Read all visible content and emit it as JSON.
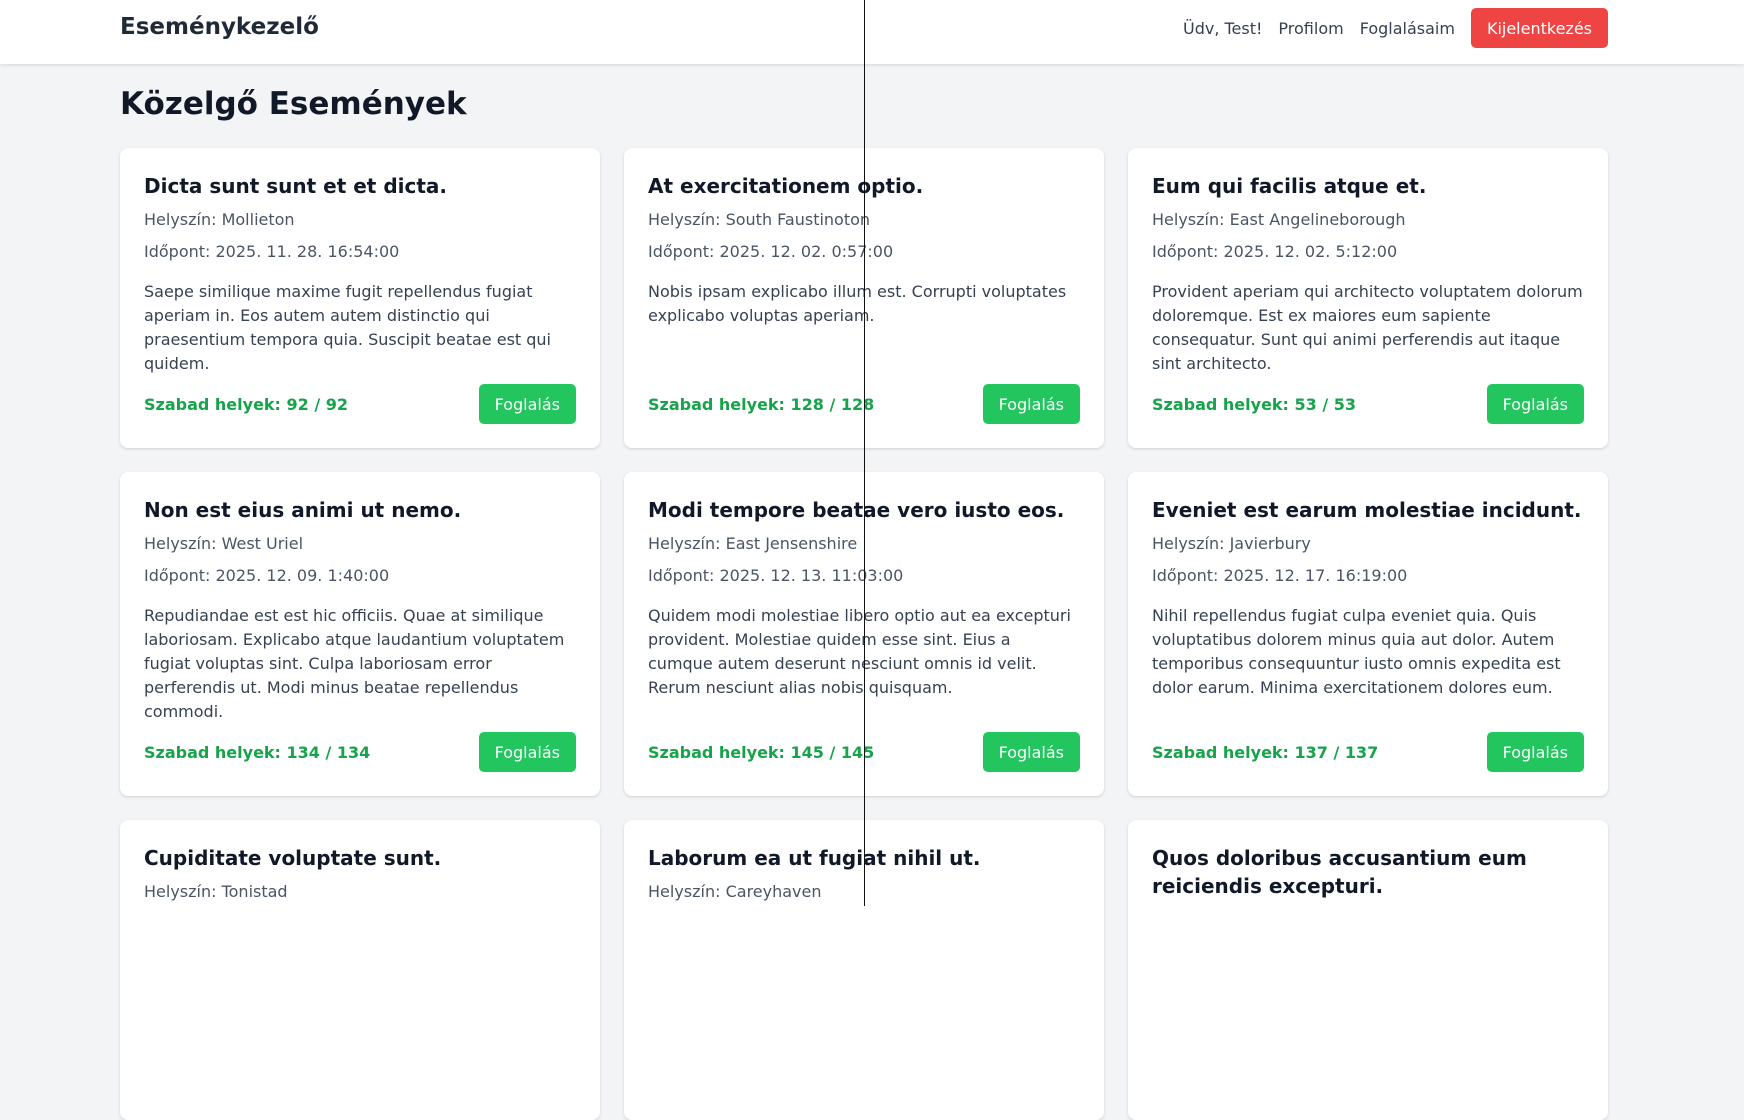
{
  "header": {
    "brand": "Eseménykezelő",
    "greeting": "Üdv, Test!",
    "profile_link": "Profilom",
    "bookings_link": "Foglalásaim",
    "logout_label": "Kijelentkezés"
  },
  "page": {
    "title": "Közelgő Események"
  },
  "labels": {
    "location_prefix": "Helyszín:",
    "time_prefix": "Időpont:",
    "seats_prefix": "Szabad helyek:",
    "book_button": "Foglalás"
  },
  "events": [
    {
      "title": "Dicta sunt sunt et et dicta.",
      "location": "Helyszín: Mollieton",
      "time": "Időpont: 2025. 11. 28. 16:54:00",
      "description": "Saepe similique maxime fugit repellendus fugiat aperiam in. Eos autem autem distinctio qui praesentium tempora quia. Suscipit beatae est qui quidem.",
      "seats": "Szabad helyek: 92 / 92",
      "book": "Foglalás"
    },
    {
      "title": "At exercitationem optio.",
      "location": "Helyszín: South Faustinoton",
      "time": "Időpont: 2025. 12. 02. 0:57:00",
      "description": "Nobis ipsam explicabo illum est. Corrupti voluptates explicabo voluptas aperiam.",
      "seats": "Szabad helyek: 128 / 128",
      "book": "Foglalás"
    },
    {
      "title": "Eum qui facilis atque et.",
      "location": "Helyszín: East Angelineborough",
      "time": "Időpont: 2025. 12. 02. 5:12:00",
      "description": "Provident aperiam qui architecto voluptatem dolorum doloremque. Est ex maiores eum sapiente consequatur. Sunt qui animi perferendis aut itaque sint architecto.",
      "seats": "Szabad helyek: 53 / 53",
      "book": "Foglalás"
    },
    {
      "title": "Non est eius animi ut nemo.",
      "location": "Helyszín: West Uriel",
      "time": "Időpont: 2025. 12. 09. 1:40:00",
      "description": "Repudiandae est est hic officiis. Quae at similique laboriosam. Explicabo atque laudantium voluptatem fugiat voluptas sint. Culpa laboriosam error perferendis ut. Modi minus beatae repellendus commodi.",
      "seats": "Szabad helyek: 134 / 134",
      "book": "Foglalás"
    },
    {
      "title": "Modi tempore beatae vero iusto eos.",
      "location": "Helyszín: East Jensenshire",
      "time": "Időpont: 2025. 12. 13. 11:03:00",
      "description": "Quidem modi molestiae libero optio aut ea excepturi provident. Molestiae quidem esse sint. Eius a cumque autem deserunt nesciunt omnis id velit. Rerum nesciunt alias nobis quisquam.",
      "seats": "Szabad helyek: 145 / 145",
      "book": "Foglalás"
    },
    {
      "title": "Eveniet est earum molestiae incidunt.",
      "location": "Helyszín: Javierbury",
      "time": "Időpont: 2025. 12. 17. 16:19:00",
      "description": "Nihil repellendus fugiat culpa eveniet quia. Quis voluptatibus dolorem minus quia aut dolor. Autem temporibus consequuntur iusto omnis expedita est dolor earum. Minima exercitationem dolores eum.",
      "seats": "Szabad helyek: 137 / 137",
      "book": "Foglalás"
    },
    {
      "title": "Cupiditate voluptate sunt.",
      "location": "Helyszín: Tonistad",
      "time": "",
      "description": "",
      "seats": "",
      "book": ""
    },
    {
      "title": "Laborum ea ut fugiat nihil ut.",
      "location": "Helyszín: Careyhaven",
      "time": "",
      "description": "",
      "seats": "",
      "book": ""
    },
    {
      "title": "Quos doloribus accusantium eum reiciendis excepturi.",
      "location": "",
      "time": "",
      "description": "",
      "seats": "",
      "book": ""
    }
  ],
  "colors": {
    "background": "#f3f4f6",
    "logout": "#ef4444",
    "book": "#22c55e",
    "seats_text": "#16a34a"
  }
}
